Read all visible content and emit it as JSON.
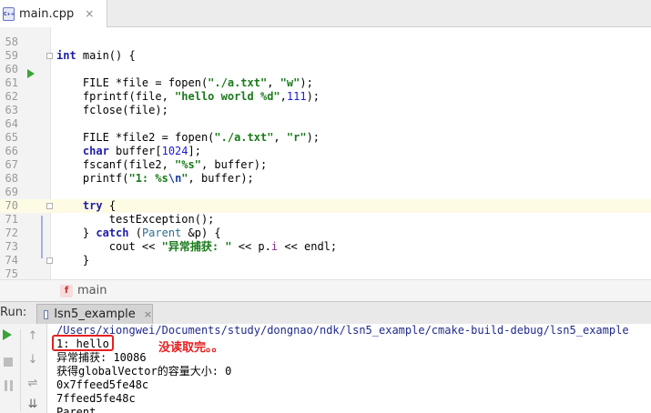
{
  "editor_tab": {
    "file_name": "main.cpp",
    "icon": "cpp-file-icon",
    "icon_text": "C++",
    "close_glyph": "×"
  },
  "editor": {
    "current_line": 70,
    "lines": [
      {
        "num": "58",
        "segments": []
      },
      {
        "num": "59",
        "segments": [
          {
            "t": "int",
            "c": "kw"
          },
          {
            "t": " main() {",
            "c": ""
          }
        ]
      },
      {
        "num": "60",
        "segments": []
      },
      {
        "num": "61",
        "segments": [
          {
            "t": "    FILE *file = fopen(",
            "c": ""
          },
          {
            "t": "\"./a.txt\"",
            "c": "str"
          },
          {
            "t": ", ",
            "c": ""
          },
          {
            "t": "\"w\"",
            "c": "str"
          },
          {
            "t": ");",
            "c": ""
          }
        ]
      },
      {
        "num": "62",
        "segments": [
          {
            "t": "    fprintf(file, ",
            "c": ""
          },
          {
            "t": "\"hello world %d\"",
            "c": "str"
          },
          {
            "t": ",",
            "c": ""
          },
          {
            "t": "111",
            "c": "num"
          },
          {
            "t": ");",
            "c": ""
          }
        ]
      },
      {
        "num": "63",
        "segments": [
          {
            "t": "    fclose(file);",
            "c": ""
          }
        ]
      },
      {
        "num": "64",
        "segments": []
      },
      {
        "num": "65",
        "segments": [
          {
            "t": "    FILE *file2 = fopen(",
            "c": ""
          },
          {
            "t": "\"./a.txt\"",
            "c": "str"
          },
          {
            "t": ", ",
            "c": ""
          },
          {
            "t": "\"r\"",
            "c": "str"
          },
          {
            "t": ");",
            "c": ""
          }
        ]
      },
      {
        "num": "66",
        "segments": [
          {
            "t": "    ",
            "c": ""
          },
          {
            "t": "char",
            "c": "kw"
          },
          {
            "t": " buffer[",
            "c": ""
          },
          {
            "t": "1024",
            "c": "num"
          },
          {
            "t": "];",
            "c": ""
          }
        ]
      },
      {
        "num": "67",
        "segments": [
          {
            "t": "    fscanf(file2, ",
            "c": ""
          },
          {
            "t": "\"%s\"",
            "c": "str"
          },
          {
            "t": ", buffer);",
            "c": ""
          }
        ]
      },
      {
        "num": "68",
        "segments": [
          {
            "t": "    printf(",
            "c": ""
          },
          {
            "t": "\"1: %s",
            "c": "str"
          },
          {
            "t": "\\n",
            "c": "esc"
          },
          {
            "t": "\"",
            "c": "str"
          },
          {
            "t": ", buffer);",
            "c": ""
          }
        ]
      },
      {
        "num": "69",
        "segments": []
      },
      {
        "num": "70",
        "segments": [
          {
            "t": "    ",
            "c": ""
          },
          {
            "t": "try",
            "c": "kw"
          },
          {
            "t": " {",
            "c": ""
          }
        ]
      },
      {
        "num": "71",
        "segments": [
          {
            "t": "        testException();",
            "c": ""
          }
        ]
      },
      {
        "num": "72",
        "segments": [
          {
            "t": "    } ",
            "c": ""
          },
          {
            "t": "catch",
            "c": "kw"
          },
          {
            "t": " (",
            "c": ""
          },
          {
            "t": "Parent",
            "c": "typ"
          },
          {
            "t": " &p) {",
            "c": ""
          }
        ]
      },
      {
        "num": "73",
        "segments": [
          {
            "t": "        cout << ",
            "c": ""
          },
          {
            "t": "\"异常捕获: \"",
            "c": "str"
          },
          {
            "t": " << p.",
            "c": ""
          },
          {
            "t": "i",
            "c": "fld"
          },
          {
            "t": " << endl;",
            "c": ""
          }
        ]
      },
      {
        "num": "74",
        "segments": [
          {
            "t": "    }",
            "c": ""
          }
        ]
      },
      {
        "num": "75",
        "segments": []
      }
    ]
  },
  "breadcrumb": {
    "icon": "function-icon",
    "icon_letter": "f",
    "label": "main"
  },
  "run_panel": {
    "label": "Run:",
    "tab_label": "lsn5_example",
    "close_glyph": "×",
    "toolbar": {
      "rerun": "rerun-icon",
      "stop": "stop-icon",
      "pause": "pause-icon",
      "up": "arrow-up-icon",
      "down": "arrow-down-icon",
      "wrap": "soft-wrap-icon",
      "scroll": "scroll-to-end-icon",
      "up_glyph": "↑",
      "down_glyph": "↓",
      "wrap_glyph": "⇌",
      "scroll_glyph": "⇊"
    }
  },
  "console": {
    "lines": [
      "/Users/xiongwei/Documents/study/dongnao/ndk/lsn5_example/cmake-build-debug/lsn5_example",
      "1: hello",
      "异常捕获: 10086",
      "获得globalVector的容量大小: 0",
      "0x7ffeed5fe48c",
      "7ffeed5fe48c",
      "Parent"
    ],
    "annotation": "没读取完。。"
  },
  "colors": {
    "accent_run": "#3aa337",
    "annotation": "#e52020",
    "current_line_bg": "#fefbe5"
  }
}
